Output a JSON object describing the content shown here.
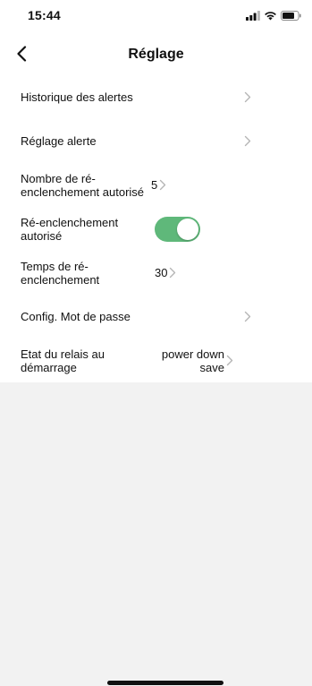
{
  "status_bar": {
    "time": "15:44",
    "icons": [
      "signal-icon",
      "wifi-icon",
      "battery-icon"
    ]
  },
  "nav": {
    "title": "Réglage",
    "back_icon": "chevron-left-icon"
  },
  "settings": {
    "rows": [
      {
        "label": "Historique des alertes",
        "value": ""
      },
      {
        "label": "Réglage alerte",
        "value": ""
      },
      {
        "label": "Nombre de ré-enclenchement autorisé",
        "value": "5"
      },
      {
        "label": "Ré-enclenchement autorisé",
        "toggle": true
      },
      {
        "label": "Temps de ré-enclenchement",
        "value": "30"
      },
      {
        "label": "Config. Mot de passe",
        "value": ""
      },
      {
        "label": "Etat du relais au démarrage",
        "value": "power down save"
      }
    ]
  },
  "colors": {
    "toggle_on": "#5fb87a",
    "background": "#f2f2f2",
    "chevron": "#b5b5b5"
  }
}
